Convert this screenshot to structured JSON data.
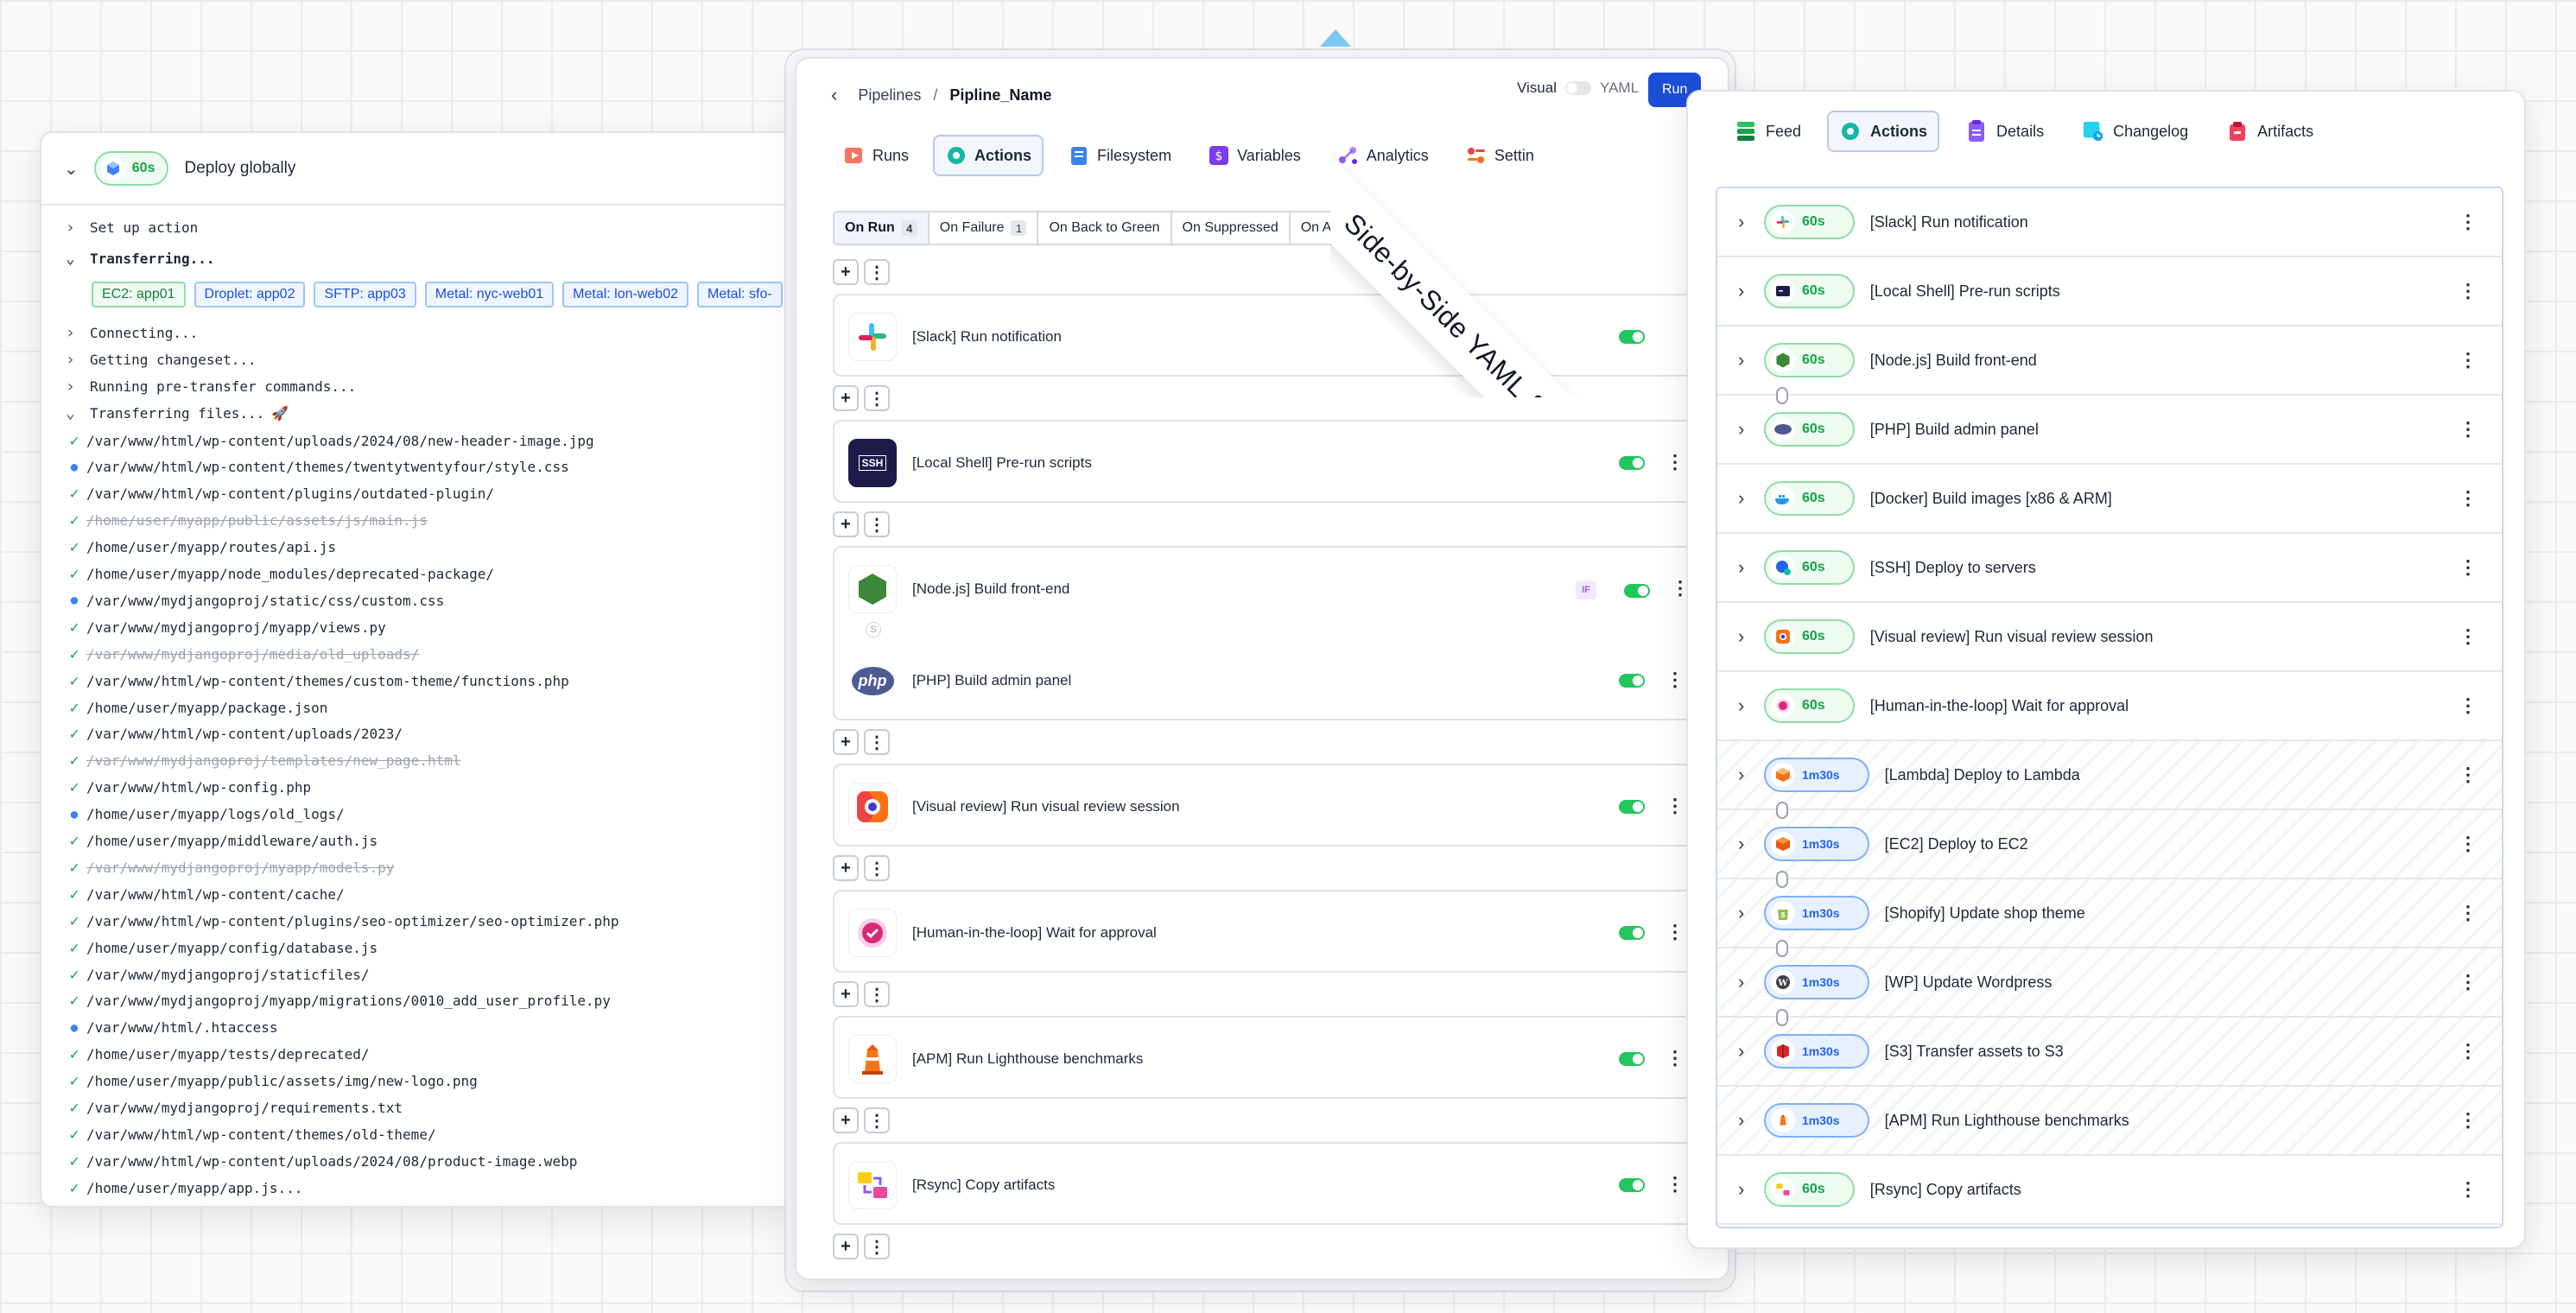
{
  "left": {
    "header": {
      "duration": "60s",
      "title": "Deploy globally"
    },
    "steps": [
      {
        "label": "Set up action",
        "expanded": false
      },
      {
        "label": "Transferring...",
        "expanded": true
      }
    ],
    "targets": [
      {
        "label": "EC2: app01",
        "kind": "green"
      },
      {
        "label": "Droplet: app02",
        "kind": "blue"
      },
      {
        "label": "SFTP: app03",
        "kind": "blue"
      },
      {
        "label": "Metal: nyc-web01",
        "kind": "blue"
      },
      {
        "label": "Metal: lon-web02",
        "kind": "blue"
      },
      {
        "label": "Metal: sfo-",
        "kind": "blue"
      }
    ],
    "substeps": [
      {
        "label": "Connecting...",
        "expanded": false
      },
      {
        "label": "Getting changeset...",
        "expanded": false
      },
      {
        "label": "Running pre-transfer commands...",
        "expanded": false
      },
      {
        "label": "Transferring files...",
        "expanded": true,
        "emoji": "🚀"
      }
    ],
    "files": [
      {
        "path": "/var/www/html/wp-content/uploads/2024/08/new-header-image.jpg",
        "status": "ok"
      },
      {
        "path": "/var/www/html/wp-content/themes/twentytwentyfour/style.css",
        "status": "modified"
      },
      {
        "path": "/var/www/html/wp-content/plugins/outdated-plugin/",
        "status": "ok"
      },
      {
        "path": "/home/user/myapp/public/assets/js/main.js",
        "status": "deleted"
      },
      {
        "path": "/home/user/myapp/routes/api.js",
        "status": "ok"
      },
      {
        "path": "/home/user/myapp/node_modules/deprecated-package/",
        "status": "ok"
      },
      {
        "path": "/var/www/mydjangoproj/static/css/custom.css",
        "status": "modified"
      },
      {
        "path": "/var/www/mydjangoproj/myapp/views.py",
        "status": "ok"
      },
      {
        "path": "/var/www/mydjangoproj/media/old_uploads/",
        "status": "deleted"
      },
      {
        "path": "/var/www/html/wp-content/themes/custom-theme/functions.php",
        "status": "ok"
      },
      {
        "path": "/home/user/myapp/package.json",
        "status": "ok"
      },
      {
        "path": "/var/www/html/wp-content/uploads/2023/",
        "status": "ok"
      },
      {
        "path": "/var/www/mydjangoproj/templates/new_page.html",
        "status": "deleted"
      },
      {
        "path": "/var/www/html/wp-config.php",
        "status": "ok"
      },
      {
        "path": "/home/user/myapp/logs/old_logs/",
        "status": "modified"
      },
      {
        "path": "/home/user/myapp/middleware/auth.js",
        "status": "ok"
      },
      {
        "path": "/var/www/mydjangoproj/myapp/models.py",
        "status": "deleted"
      },
      {
        "path": "/var/www/html/wp-content/cache/",
        "status": "ok"
      },
      {
        "path": "/var/www/html/wp-content/plugins/seo-optimizer/seo-optimizer.php",
        "status": "ok"
      },
      {
        "path": "/home/user/myapp/config/database.js",
        "status": "ok"
      },
      {
        "path": "/var/www/mydjangoproj/staticfiles/",
        "status": "ok"
      },
      {
        "path": "/var/www/mydjangoproj/myapp/migrations/0010_add_user_profile.py",
        "status": "ok"
      },
      {
        "path": "/var/www/html/.htaccess",
        "status": "modified"
      },
      {
        "path": "/home/user/myapp/tests/deprecated/",
        "status": "ok"
      },
      {
        "path": "/home/user/myapp/public/assets/img/new-logo.png",
        "status": "ok"
      },
      {
        "path": "/var/www/mydjangoproj/requirements.txt",
        "status": "ok"
      },
      {
        "path": "/var/www/html/wp-content/themes/old-theme/",
        "status": "ok"
      },
      {
        "path": "/var/www/html/wp-content/uploads/2024/08/product-image.webp",
        "status": "ok"
      },
      {
        "path": "/home/user/myapp/app.js...",
        "status": "ok"
      }
    ]
  },
  "middle": {
    "breadcrumb": {
      "root": "Pipelines",
      "separator": "/",
      "current": "Pipline_Name"
    },
    "mode": {
      "visual": "Visual",
      "yaml": "YAML"
    },
    "run_label": "Run",
    "tabs": [
      {
        "label": "Runs",
        "icon": "runs-icon",
        "color": "#e8523a"
      },
      {
        "label": "Actions",
        "icon": "actions-gear-icon",
        "color": "#14b8a6",
        "active": true
      },
      {
        "label": "Filesystem",
        "icon": "filesystem-icon",
        "color": "#3b82f6"
      },
      {
        "label": "Variables",
        "icon": "variables-icon",
        "color": "#7c3aed"
      },
      {
        "label": "Analytics",
        "icon": "analytics-icon",
        "color": "#8b5cf6"
      },
      {
        "label": "Settin",
        "icon": "settings-icon",
        "color": "#ef4444"
      }
    ],
    "triggers": [
      {
        "label": "On Run",
        "count": "4",
        "active": true
      },
      {
        "label": "On Failure",
        "count": "1"
      },
      {
        "label": "On Back to Green"
      },
      {
        "label": "On Suppressed"
      },
      {
        "label": "On Approve"
      }
    ],
    "actions": [
      {
        "label": "[Slack] Run notification",
        "icon": "slack-icon"
      },
      {
        "label": "[Local Shell] Pre-run scripts",
        "icon": "ssh-terminal-icon",
        "icon_text": "SSH"
      },
      {
        "label": "[Node.js] Build front-end",
        "icon": "nodejs-icon",
        "if_badge": "IF",
        "link_badge": "S"
      },
      {
        "label": "[PHP] Build admin panel",
        "icon": "php-icon",
        "icon_text": "php"
      },
      {
        "label": "[Visual review] Run visual review session",
        "icon": "visual-review-icon"
      },
      {
        "label": "[Human-in-the-loop] Wait for approval",
        "icon": "approval-icon"
      },
      {
        "label": "[APM] Run Lighthouse benchmarks",
        "icon": "lighthouse-icon"
      },
      {
        "label": "[Rsync] Copy artifacts",
        "icon": "rsync-icon"
      }
    ]
  },
  "ribbon": {
    "text": "Side-by-Side YAML & Visual Editor"
  },
  "right": {
    "tabs": [
      {
        "label": "Feed",
        "icon": "feed-icon",
        "color": "#16a34a"
      },
      {
        "label": "Actions",
        "icon": "actions-gear-icon",
        "color": "#14b8a6",
        "active": true
      },
      {
        "label": "Details",
        "icon": "details-icon",
        "color": "#7c3aed"
      },
      {
        "label": "Changelog",
        "icon": "changelog-icon",
        "color": "#0ea5e9"
      },
      {
        "label": "Artifacts",
        "icon": "artifacts-icon",
        "color": "#e11d48"
      }
    ],
    "items": [
      {
        "label": "[Slack] Run notification",
        "duration": "60s",
        "state": "done",
        "icon": "slack-icon"
      },
      {
        "label": "[Local Shell] Pre-run scripts",
        "duration": "60s",
        "state": "done",
        "icon": "terminal-icon"
      },
      {
        "label": "[Node.js] Build front-end",
        "duration": "60s",
        "state": "done",
        "icon": "nodejs-icon"
      },
      {
        "label": "[PHP] Build admin panel",
        "duration": "60s",
        "state": "done",
        "icon": "php-icon"
      },
      {
        "label": "[Docker] Build images [x86 & ARM]",
        "duration": "60s",
        "state": "done",
        "icon": "docker-icon"
      },
      {
        "label": "[SSH] Deploy to servers",
        "duration": "60s",
        "state": "done",
        "icon": "ssh-icon"
      },
      {
        "label": "[Visual review] Run visual review session",
        "duration": "60s",
        "state": "done",
        "icon": "visual-review-icon"
      },
      {
        "label": "[Human-in-the-loop] Wait for approval",
        "duration": "60s",
        "state": "done",
        "icon": "approval-icon"
      },
      {
        "label": "[Lambda] Deploy to Lambda",
        "duration": "1m30s",
        "state": "running",
        "icon": "lambda-icon"
      },
      {
        "label": "[EC2] Deploy to EC2",
        "duration": "1m30s",
        "state": "running",
        "icon": "ec2-icon"
      },
      {
        "label": "[Shopify] Update shop theme",
        "duration": "1m30s",
        "state": "running",
        "icon": "shopify-icon"
      },
      {
        "label": "[WP] Update Wordpress",
        "duration": "1m30s",
        "state": "running",
        "icon": "wordpress-icon"
      },
      {
        "label": "[S3] Transfer assets to S3",
        "duration": "1m30s",
        "state": "running",
        "icon": "s3-icon"
      },
      {
        "label": "[APM] Run Lighthouse benchmarks",
        "duration": "1m30s",
        "state": "running",
        "icon": "lighthouse-icon"
      },
      {
        "label": "[Rsync] Copy artifacts",
        "duration": "60s",
        "state": "done",
        "icon": "rsync-icon"
      }
    ]
  }
}
